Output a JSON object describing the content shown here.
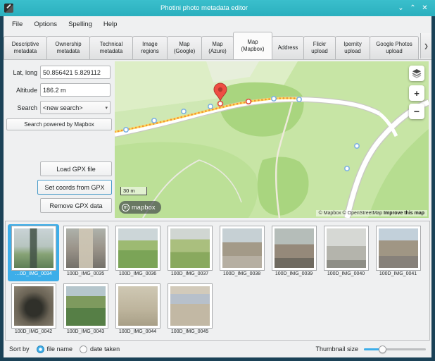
{
  "colors": {
    "accent": "#3daee9",
    "titlebar": "#2eb4c3",
    "selection": "#3daee9"
  },
  "icons": {
    "minimize": "⌄",
    "maximize": "⌃",
    "close": "✕",
    "scroll_right": "❯",
    "dropdown": "▾"
  },
  "window": {
    "title": "Photini photo metadata editor"
  },
  "menu": {
    "items": [
      {
        "label": "File"
      },
      {
        "label": "Options"
      },
      {
        "label": "Spelling"
      },
      {
        "label": "Help"
      }
    ]
  },
  "tabs": {
    "items": [
      {
        "label": "Descriptive metadata",
        "selected": false
      },
      {
        "label": "Ownership metadata",
        "selected": false
      },
      {
        "label": "Technical metadata",
        "selected": false
      },
      {
        "label": "Image regions",
        "selected": false
      },
      {
        "label": "Map (Google)",
        "selected": false
      },
      {
        "label": "Map (Azure)",
        "selected": false
      },
      {
        "label": "Map (Mapbox)",
        "selected": true
      },
      {
        "label": "Address",
        "selected": false
      },
      {
        "label": "Flickr upload",
        "selected": false
      },
      {
        "label": "Ipernity upload",
        "selected": false
      },
      {
        "label": "Google Photos upload",
        "selected": false
      }
    ]
  },
  "gps_panel": {
    "lat_long_label": "Lat, long",
    "lat_long_value": "50.856421 5.829112",
    "altitude_label": "Altitude",
    "altitude_value": "186.2 m",
    "search_label": "Search",
    "search_value": "<new search>",
    "search_powered_label": "Search powered by Mapbox",
    "load_gpx_label": "Load GPX file",
    "set_coords_label": "Set coords from GPX",
    "remove_gpx_label": "Remove GPX data"
  },
  "map": {
    "scale_label": "30 m",
    "logo_label": "mapbox",
    "attribution": "© Mapbox © OpenStreetMap",
    "improve_label": "Improve this map",
    "zoom_in_label": "+",
    "zoom_out_label": "−"
  },
  "thumbnails": {
    "items": [
      {
        "name": "…0D_IMG_0034",
        "selected": true
      },
      {
        "name": "100D_IMG_0035",
        "selected": false
      },
      {
        "name": "100D_IMG_0036",
        "selected": false
      },
      {
        "name": "100D_IMG_0037",
        "selected": false
      },
      {
        "name": "100D_IMG_0038",
        "selected": false
      },
      {
        "name": "100D_IMG_0039",
        "selected": false
      },
      {
        "name": "100D_IMG_0040",
        "selected": false
      },
      {
        "name": "100D_IMG_0041",
        "selected": false
      },
      {
        "name": "100D_IMG_0042",
        "selected": false
      },
      {
        "name": "100D_IMG_0043",
        "selected": false
      },
      {
        "name": "100D_IMG_0044",
        "selected": false
      },
      {
        "name": "100D_IMG_0045",
        "selected": false
      }
    ]
  },
  "footer": {
    "sort_by_label": "Sort by",
    "options": [
      {
        "label": "file name",
        "selected": true
      },
      {
        "label": "date taken",
        "selected": false
      }
    ],
    "thumbnail_size_label": "Thumbnail size"
  }
}
